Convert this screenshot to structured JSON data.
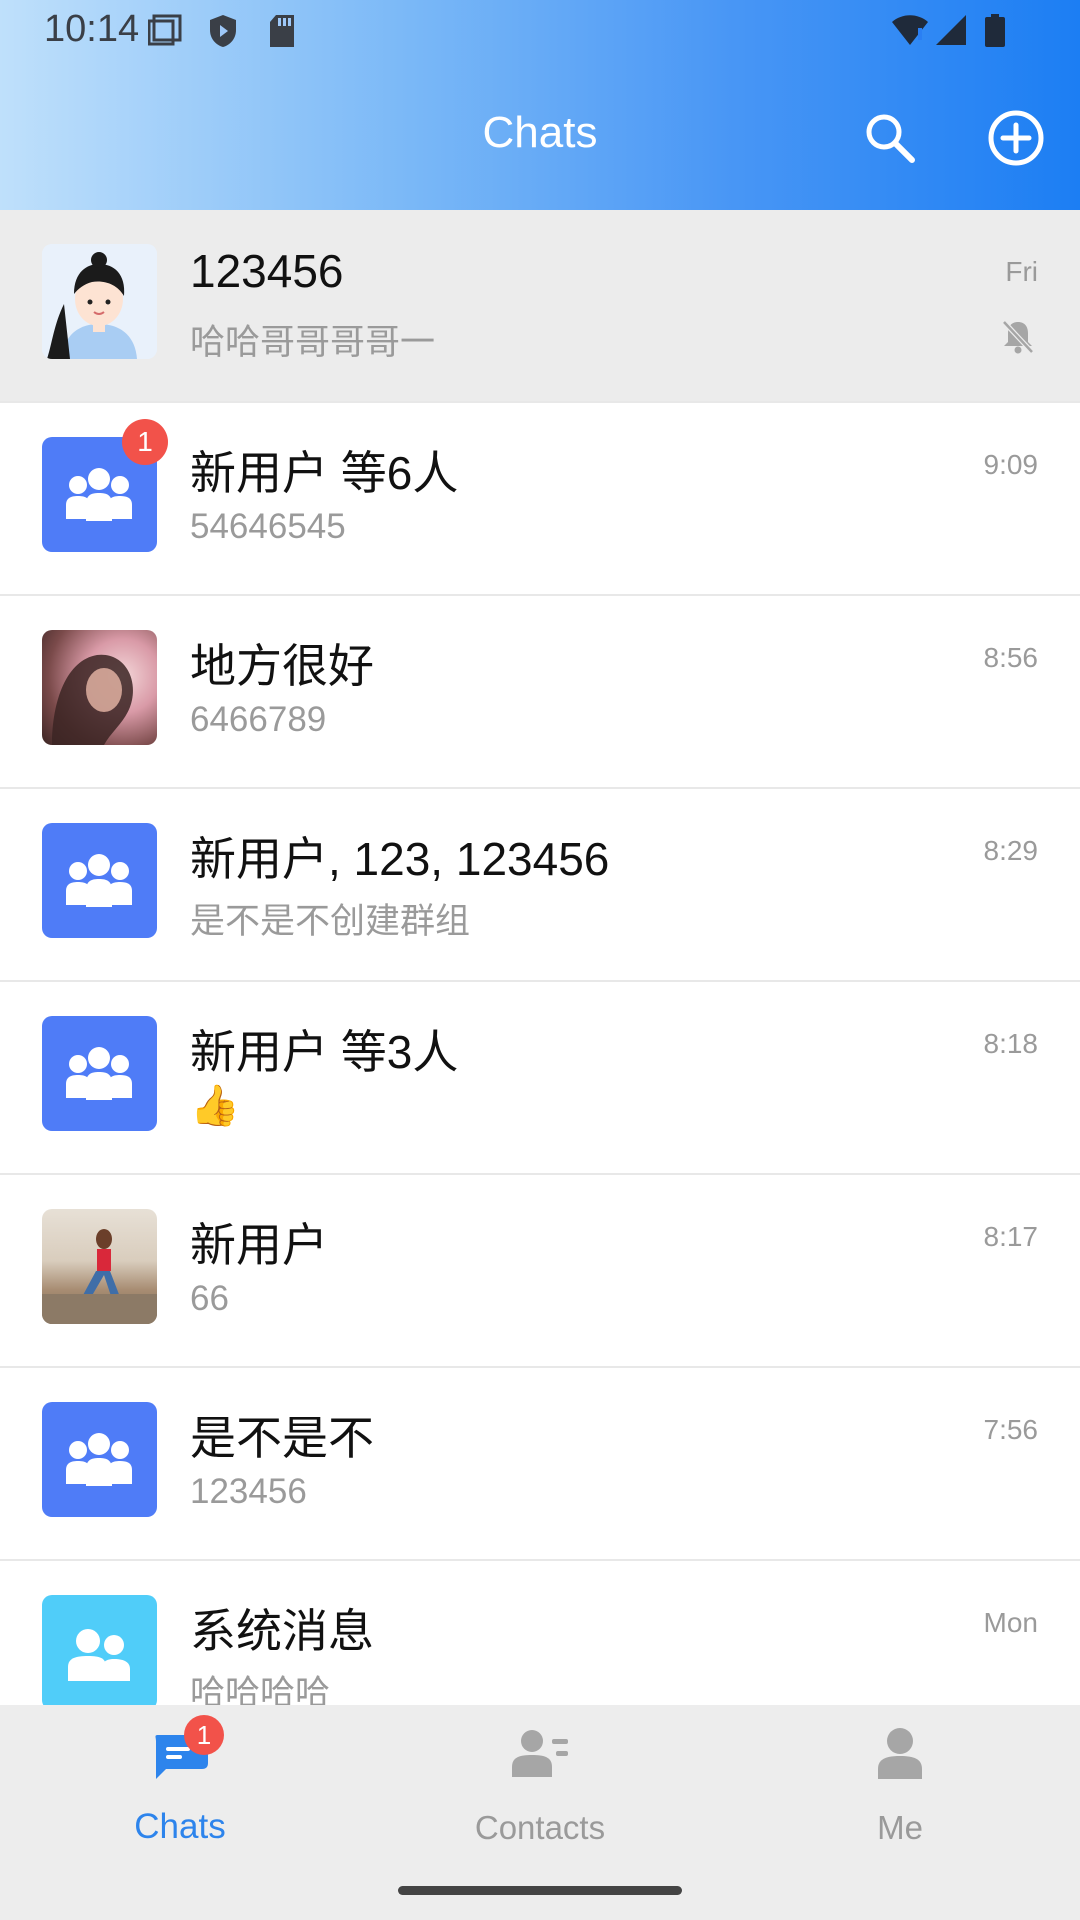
{
  "status_bar": {
    "time": "10:14",
    "icons": [
      "screen-icon",
      "shield-play-icon",
      "sd-card-icon",
      "wifi-icon",
      "signal-icon",
      "battery-icon"
    ]
  },
  "header": {
    "title": "Chats",
    "search_icon": "search-icon",
    "add_icon": "plus-circle-icon"
  },
  "colors": {
    "accent": "#2d84ec",
    "group_avatar": "#4f7cf7",
    "system_avatar": "#50cdf9",
    "badge": "#f2524a"
  },
  "chats": [
    {
      "name": "123456",
      "preview": "哈哈哥哥哥哥一",
      "time": "Fri",
      "pinned": true,
      "muted": true,
      "avatar": "cartoon-girl"
    },
    {
      "name": "新用户 等6人",
      "preview": "54646545",
      "time": "9:09",
      "unread": "1",
      "avatar": "group"
    },
    {
      "name": "地方很好",
      "preview": "6466789",
      "time": "8:56",
      "avatar": "photo-portrait"
    },
    {
      "name": "新用户, 123, 123456",
      "preview": "是不是不创建群组",
      "time": "8:29",
      "avatar": "group"
    },
    {
      "name": "新用户 等3人",
      "preview": "👍",
      "time": "8:18",
      "avatar": "group"
    },
    {
      "name": "新用户",
      "preview": "66",
      "time": "8:17",
      "avatar": "photo-beach"
    },
    {
      "name": "是不是不",
      "preview": "123456",
      "time": "7:56",
      "avatar": "group"
    },
    {
      "name": "系统消息",
      "preview": "哈哈哈哈",
      "time": "Mon",
      "avatar": "system"
    }
  ],
  "bottom_nav": {
    "items": [
      {
        "label": "Chats",
        "icon": "chat-bubble-icon",
        "active": true,
        "badge": "1"
      },
      {
        "label": "Contacts",
        "icon": "contacts-icon",
        "active": false
      },
      {
        "label": "Me",
        "icon": "person-icon",
        "active": false
      }
    ]
  }
}
